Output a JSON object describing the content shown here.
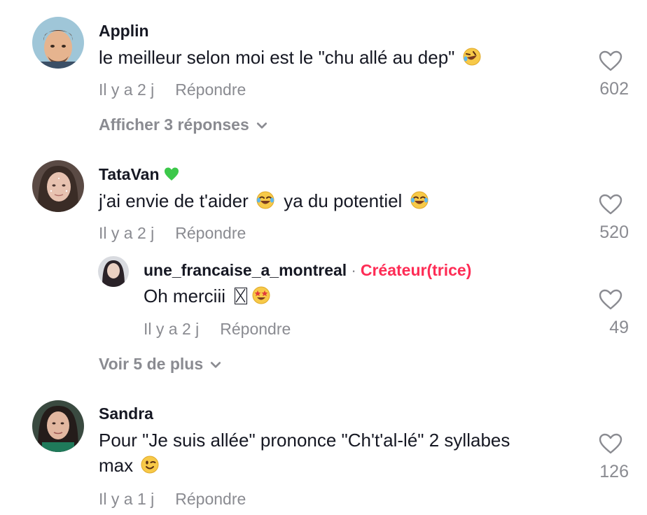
{
  "comments": [
    {
      "username": "Applin",
      "text": "le meilleur selon moi est le \"chu allé au dep\"",
      "emoji": "rolling-on-floor-laughing",
      "time": "Il y a 2 j",
      "reply_label": "Répondre",
      "likes": "602",
      "view_replies": "Afficher 3 réponses"
    },
    {
      "username": "TataVan",
      "username_emoji": "green-heart",
      "text_a": "j'ai envie de t'aider",
      "text_b": "ya du potentiel",
      "emoji": "face-with-tears-of-joy",
      "time": "Il y a 2 j",
      "reply_label": "Répondre",
      "likes": "520",
      "reply": {
        "username": "une_francaise_a_montreal",
        "separator": "·",
        "role": "Créateur(trice)",
        "text": "Oh merciii",
        "emoji": "star-struck",
        "time": "Il y a 2 j",
        "reply_label": "Répondre",
        "likes": "49"
      },
      "view_more": "Voir 5 de plus"
    },
    {
      "username": "Sandra",
      "text_line1": "Pour \"Je suis allée\" prononce \"Ch't'al-lé\" 2 syllabes",
      "text_line2": "max",
      "emoji": "winking-face",
      "time": "Il y a 1 j",
      "reply_label": "Répondre",
      "likes": "126"
    }
  ],
  "colors": {
    "text": "#161823",
    "secondary": "#8a8b91",
    "creator": "#fe2c55"
  }
}
